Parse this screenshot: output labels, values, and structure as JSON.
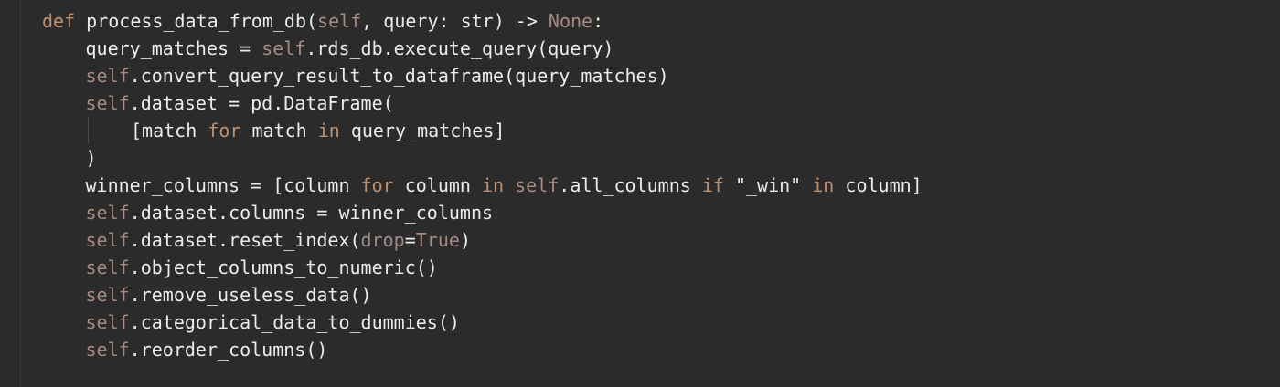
{
  "code_lines": [
    {
      "indent": 0,
      "tokens": [
        {
          "t": "def ",
          "k": "kw"
        },
        {
          "t": "process_data_from_db(",
          "k": "txt"
        },
        {
          "t": "self",
          "k": "self"
        },
        {
          "t": ", query: str) -> ",
          "k": "txt"
        },
        {
          "t": "None",
          "k": "self"
        },
        {
          "t": ":",
          "k": "txt"
        }
      ]
    },
    {
      "indent": 1,
      "tokens": [
        {
          "t": "query_matches = ",
          "k": "txt"
        },
        {
          "t": "self",
          "k": "self"
        },
        {
          "t": ".rds_db.execute_query(query)",
          "k": "txt"
        }
      ]
    },
    {
      "indent": 1,
      "tokens": [
        {
          "t": "self",
          "k": "self"
        },
        {
          "t": ".convert_query_result_to_dataframe(query_matches)",
          "k": "txt"
        }
      ]
    },
    {
      "indent": 1,
      "tokens": [
        {
          "t": "self",
          "k": "self"
        },
        {
          "t": ".dataset = pd.DataFrame(",
          "k": "txt"
        }
      ]
    },
    {
      "indent": 2,
      "guide": true,
      "tokens": [
        {
          "t": "[match ",
          "k": "txt"
        },
        {
          "t": "for",
          "k": "kw"
        },
        {
          "t": " match ",
          "k": "txt"
        },
        {
          "t": "in",
          "k": "kw"
        },
        {
          "t": " query_matches]",
          "k": "txt"
        }
      ]
    },
    {
      "indent": 1,
      "tokens": [
        {
          "t": ")",
          "k": "txt"
        }
      ]
    },
    {
      "indent": 1,
      "tokens": [
        {
          "t": "winner_columns = [column ",
          "k": "txt"
        },
        {
          "t": "for",
          "k": "kw"
        },
        {
          "t": " column ",
          "k": "txt"
        },
        {
          "t": "in",
          "k": "kw"
        },
        {
          "t": " ",
          "k": "txt"
        },
        {
          "t": "self",
          "k": "self"
        },
        {
          "t": ".all_columns ",
          "k": "txt"
        },
        {
          "t": "if",
          "k": "kw"
        },
        {
          "t": " \"_win\" ",
          "k": "str"
        },
        {
          "t": "in",
          "k": "kw"
        },
        {
          "t": " column]",
          "k": "txt"
        }
      ]
    },
    {
      "indent": 1,
      "tokens": [
        {
          "t": "self",
          "k": "self"
        },
        {
          "t": ".dataset.columns = winner_columns",
          "k": "txt"
        }
      ]
    },
    {
      "indent": 1,
      "tokens": [
        {
          "t": "self",
          "k": "self"
        },
        {
          "t": ".dataset.reset_index(",
          "k": "txt"
        },
        {
          "t": "drop",
          "k": "param"
        },
        {
          "t": "=",
          "k": "txt"
        },
        {
          "t": "True",
          "k": "self"
        },
        {
          "t": ")",
          "k": "txt"
        }
      ]
    },
    {
      "indent": 1,
      "tokens": [
        {
          "t": "self",
          "k": "self"
        },
        {
          "t": ".object_columns_to_numeric()",
          "k": "txt"
        }
      ]
    },
    {
      "indent": 1,
      "tokens": [
        {
          "t": "self",
          "k": "self"
        },
        {
          "t": ".remove_useless_data()",
          "k": "txt"
        }
      ]
    },
    {
      "indent": 1,
      "tokens": [
        {
          "t": "self",
          "k": "self"
        },
        {
          "t": ".categorical_data_to_dummies()",
          "k": "txt"
        }
      ]
    },
    {
      "indent": 1,
      "tokens": [
        {
          "t": "self",
          "k": "self"
        },
        {
          "t": ".reorder_columns()",
          "k": "txt"
        }
      ]
    }
  ]
}
